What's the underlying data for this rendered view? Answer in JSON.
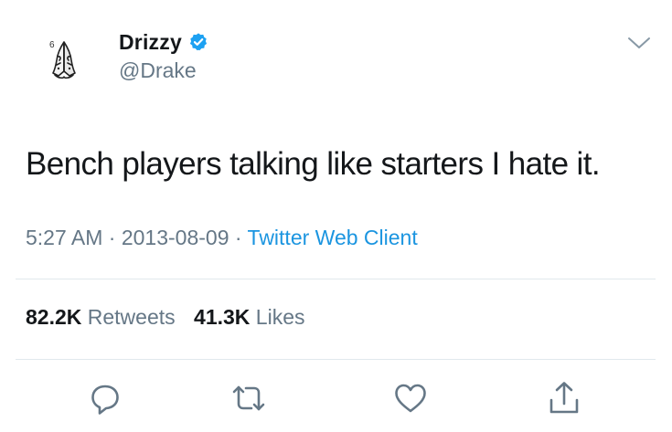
{
  "user": {
    "display_name": "Drizzy",
    "handle": "@Drake",
    "verified": true,
    "avatar_icon": "praying-hands-icon",
    "avatar_badge": "6"
  },
  "tweet": {
    "text": "Bench players talking like starters I hate it.",
    "time": "5:27 AM",
    "separator": "·",
    "date": "2013-08-09",
    "client": "Twitter Web Client"
  },
  "stats": {
    "retweets_count": "82.2K",
    "retweets_label": "Retweets",
    "likes_count": "41.3K",
    "likes_label": "Likes"
  },
  "actions": [
    {
      "name": "reply",
      "icon": "comment-icon"
    },
    {
      "name": "retweet",
      "icon": "retweet-icon"
    },
    {
      "name": "like",
      "icon": "heart-icon"
    },
    {
      "name": "share",
      "icon": "share-icon"
    }
  ],
  "colors": {
    "text_primary": "#14171a",
    "text_secondary": "#657786",
    "link_blue": "#1b95e0",
    "verified_blue": "#1da1f2",
    "divider": "#e1e8ed"
  }
}
